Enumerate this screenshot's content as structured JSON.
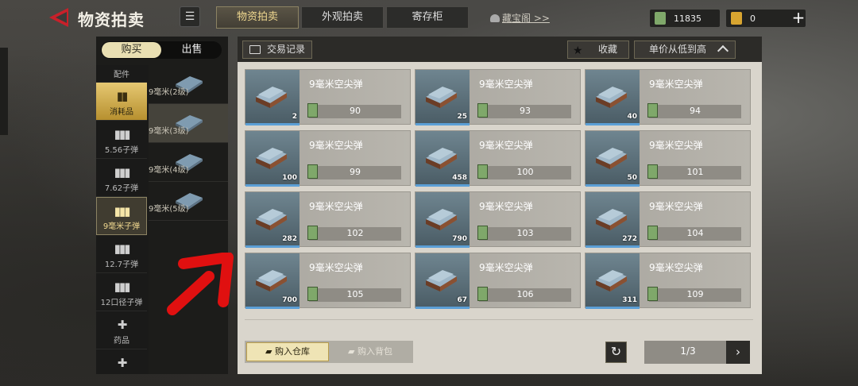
{
  "header": {
    "title": "物资拍卖",
    "tabs": [
      "物资拍卖",
      "外观拍卖",
      "寄存柜"
    ],
    "active_tab": 0,
    "vault_link": "藏宝阁 >>",
    "cash": "11835",
    "tickets": "0",
    "plus": "+"
  },
  "sidebar": {
    "buy_label": "购买",
    "sell_label": "出售",
    "categories": [
      {
        "label": "配件",
        "glyph": ""
      },
      {
        "label": "消耗品",
        "glyph": "▮▮"
      },
      {
        "label": "5.56子弹",
        "glyph": "▮▮▮"
      },
      {
        "label": "7.62子弹",
        "glyph": "▮▮▮"
      },
      {
        "label": "9毫米子弹",
        "glyph": "▮▮▮"
      },
      {
        "label": "12.7子弹",
        "glyph": "▮▮▮"
      },
      {
        "label": "12口径子弹",
        "glyph": "▮▮▮"
      },
      {
        "label": "药品",
        "glyph": "✚"
      },
      {
        "label": "",
        "glyph": "✚"
      }
    ],
    "subitems": [
      "9毫米(2级)",
      "9毫米(3级)",
      "9毫米(4级)",
      "9毫米(5级)"
    ]
  },
  "main": {
    "records_label": "交易记录",
    "fav_label": "收藏",
    "sort_label": "单价从低到高",
    "items": [
      {
        "name": "9毫米空尖弹",
        "qty": "2",
        "price": "90"
      },
      {
        "name": "9毫米空尖弹",
        "qty": "25",
        "price": "93"
      },
      {
        "name": "9毫米空尖弹",
        "qty": "40",
        "price": "94"
      },
      {
        "name": "9毫米空尖弹",
        "qty": "100",
        "price": "99"
      },
      {
        "name": "9毫米空尖弹",
        "qty": "458",
        "price": "100"
      },
      {
        "name": "9毫米空尖弹",
        "qty": "50",
        "price": "101"
      },
      {
        "name": "9毫米空尖弹",
        "qty": "282",
        "price": "102"
      },
      {
        "name": "9毫米空尖弹",
        "qty": "790",
        "price": "103"
      },
      {
        "name": "9毫米空尖弹",
        "qty": "272",
        "price": "104"
      },
      {
        "name": "9毫米空尖弹",
        "qty": "700",
        "price": "105"
      },
      {
        "name": "9毫米空尖弹",
        "qty": "67",
        "price": "106"
      },
      {
        "name": "9毫米空尖弹",
        "qty": "311",
        "price": "109"
      }
    ],
    "warehouse_label": "购入仓库",
    "bag_label": "购入背包",
    "page": "1/3"
  },
  "colors": {
    "accent": "#e6c872",
    "highlight_blue": "#5b9fd6",
    "arrow": "#e01010"
  }
}
